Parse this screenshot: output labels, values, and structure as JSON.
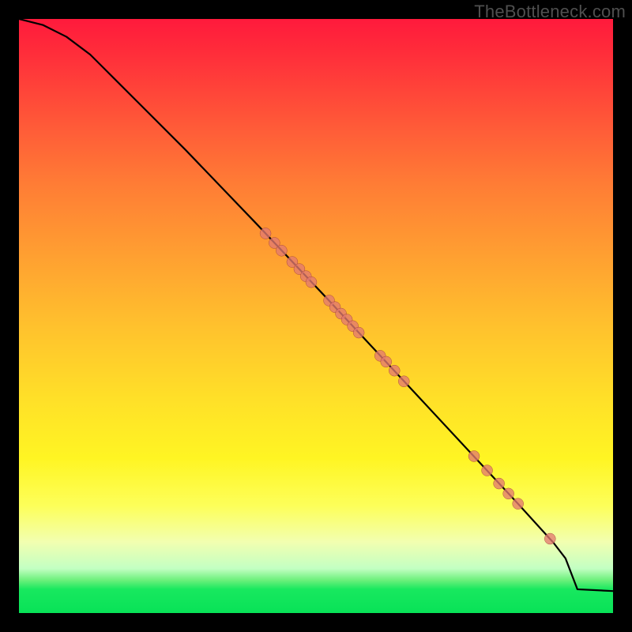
{
  "watermark": "TheBottleneck.com",
  "colors": {
    "page_bg": "#000000",
    "gradient_top": "#ff1a3c",
    "gradient_mid": "#ffe028",
    "gradient_bottom": "#08e257",
    "curve": "#000000",
    "dot_fill": "#e37a6f",
    "dot_stroke": "#9a3d30"
  },
  "chart_data": {
    "type": "line",
    "title": "",
    "xlabel": "",
    "ylabel": "",
    "xlim": [
      0,
      100
    ],
    "ylim": [
      0,
      100
    ],
    "series": [
      {
        "name": "curve",
        "x": [
          0,
          4,
          8,
          12,
          16,
          20,
          28,
          40,
          52,
          60,
          68,
          76,
          84,
          90,
          92,
          94,
          100
        ],
        "y": [
          100,
          99,
          97,
          94,
          90,
          86,
          78,
          65.5,
          52.8,
          44.2,
          35.6,
          27,
          18.4,
          11.8,
          9.2,
          4,
          3.7
        ]
      }
    ],
    "points": [
      {
        "name": "p1",
        "x": 41.5,
        "y": 63.9
      },
      {
        "name": "p2",
        "x": 43.0,
        "y": 62.3
      },
      {
        "name": "p3",
        "x": 44.2,
        "y": 61.0
      },
      {
        "name": "p4",
        "x": 46.0,
        "y": 59.1
      },
      {
        "name": "p5",
        "x": 47.2,
        "y": 57.9
      },
      {
        "name": "p6",
        "x": 48.3,
        "y": 56.7
      },
      {
        "name": "p7",
        "x": 49.2,
        "y": 55.7
      },
      {
        "name": "p8",
        "x": 52.2,
        "y": 52.6
      },
      {
        "name": "p9",
        "x": 53.2,
        "y": 51.5
      },
      {
        "name": "p10",
        "x": 54.2,
        "y": 50.4
      },
      {
        "name": "p11",
        "x": 55.2,
        "y": 49.4
      },
      {
        "name": "p12",
        "x": 56.2,
        "y": 48.3
      },
      {
        "name": "p13",
        "x": 57.2,
        "y": 47.2
      },
      {
        "name": "p14",
        "x": 60.8,
        "y": 43.3
      },
      {
        "name": "p15",
        "x": 61.8,
        "y": 42.3
      },
      {
        "name": "p16",
        "x": 63.2,
        "y": 40.8
      },
      {
        "name": "p17",
        "x": 64.8,
        "y": 39.0
      },
      {
        "name": "p18",
        "x": 76.6,
        "y": 26.4
      },
      {
        "name": "p19",
        "x": 78.8,
        "y": 24.0
      },
      {
        "name": "p20",
        "x": 80.8,
        "y": 21.8
      },
      {
        "name": "p21",
        "x": 82.4,
        "y": 20.1
      },
      {
        "name": "p22",
        "x": 84.0,
        "y": 18.4
      },
      {
        "name": "p23",
        "x": 89.4,
        "y": 12.5
      }
    ],
    "point_radius": 7
  }
}
